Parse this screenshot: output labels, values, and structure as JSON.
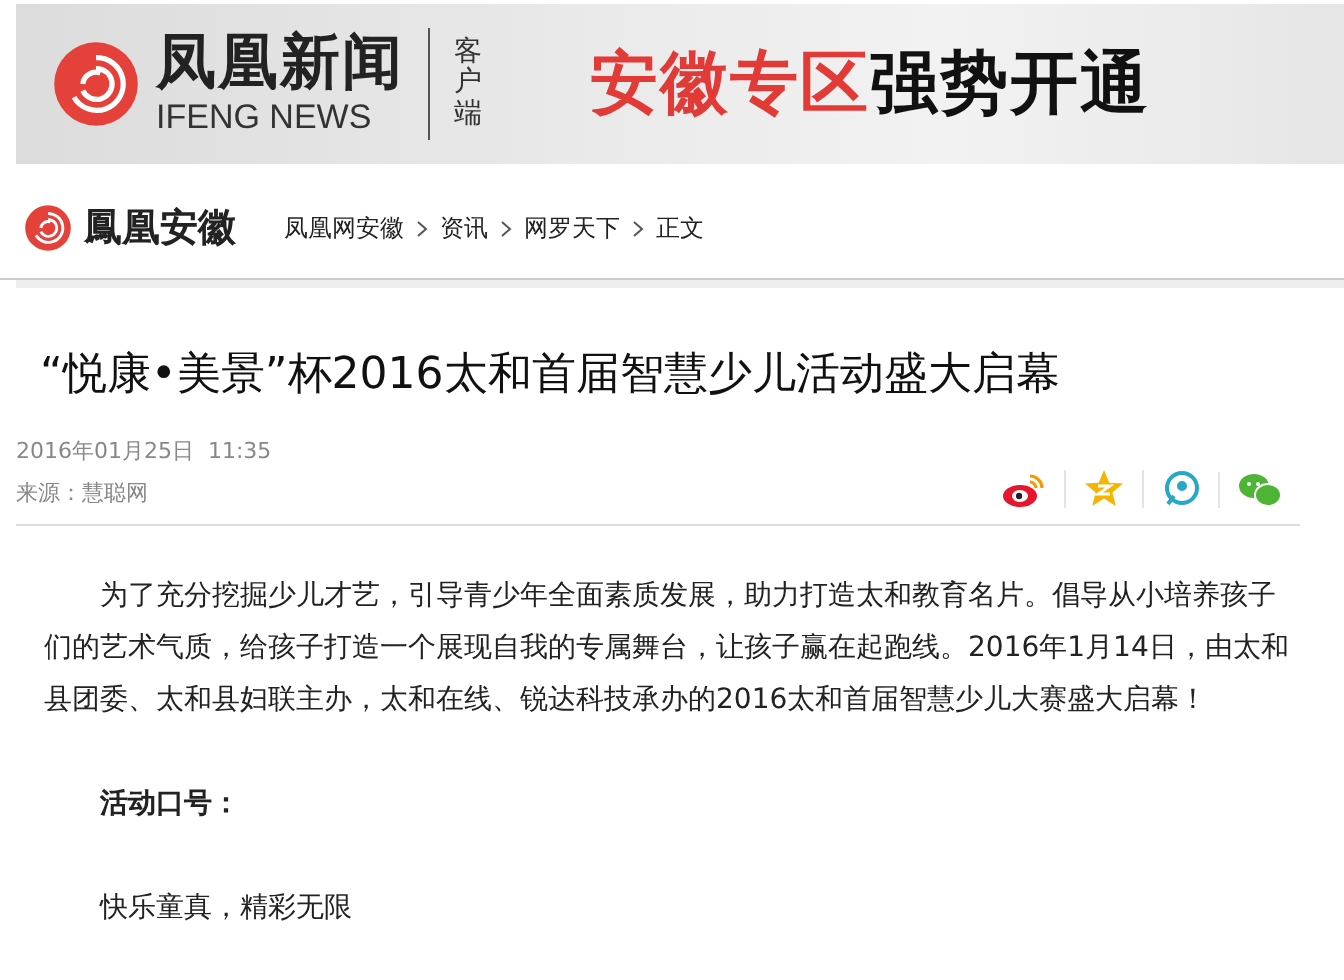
{
  "banner": {
    "brand": "凤凰新闻",
    "brand_en": "IFENG NEWS",
    "client": "客户端",
    "slogan_highlight": "安徽专区",
    "slogan": "强势开通"
  },
  "site": {
    "name": "鳳凰安徽"
  },
  "breadcrumb": [
    "凤凰网安徽",
    "资讯",
    "网罗天下",
    "正文"
  ],
  "article": {
    "title": "“悦康•美景”杯2016太和首届智慧少儿活动盛大启幕",
    "date": "2016年01月25日  11:35",
    "source": "来源：慧聪网",
    "share": [
      {
        "kind": "weibo"
      },
      {
        "kind": "qzone"
      },
      {
        "kind": "tweet"
      },
      {
        "kind": "wechat"
      }
    ],
    "paragraphs": [
      {
        "kind": "text",
        "text": "为了充分挖掘少儿才艺，引导青少年全面素质发展，助力打造太和教育名片。倡导从小培养孩子们的艺术气质，给孩子打造一个展现自我的专属舞台，让孩子赢在起跑线。2016年1月14日，由太和县团委、太和县妇联主办，太和在线、锐达科技承办的2016太和首届智慧少儿大赛盛大启幕！"
      },
      {
        "kind": "heading",
        "text": "活动口号："
      },
      {
        "kind": "text",
        "text": "快乐童真，精彩无限"
      }
    ]
  }
}
